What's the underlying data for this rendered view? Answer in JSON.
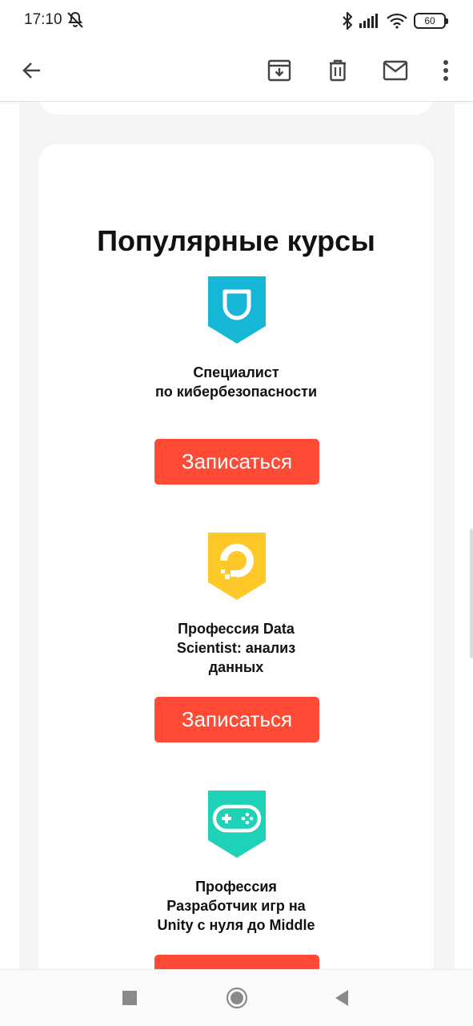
{
  "status_bar": {
    "time": "17:10",
    "battery": "60",
    "icons": [
      "mute-icon",
      "bluetooth-icon",
      "signal-icon",
      "wifi-icon",
      "battery-icon"
    ]
  },
  "toolbar": {
    "icons": [
      "back-arrow-icon",
      "archive-icon",
      "delete-icon",
      "mark-unread-icon",
      "more-vert-icon"
    ]
  },
  "email": {
    "section_title": "Популярные курсы",
    "courses": [
      {
        "name": "Специалист\nпо кибербезопасности",
        "button_label": "Записаться",
        "icon": "shield-icon",
        "color": "#16b6d6"
      },
      {
        "name": "Профессия Data\nScientist: анализ\nданных",
        "button_label": "Записаться",
        "icon": "digitalocean-logo-icon",
        "color": "#ffc829"
      },
      {
        "name": "Профессия\nРазработчик игр на\nUnity с нуля до Middle",
        "button_label": "Записаться",
        "icon": "gamepad-icon",
        "color": "#1fd1b6"
      }
    ]
  },
  "colors": {
    "button": "#ff4a35",
    "background": "#f4f4f4"
  },
  "nav_bar": {
    "icons": [
      "recents-square-icon",
      "home-circle-icon",
      "back-triangle-icon"
    ]
  }
}
